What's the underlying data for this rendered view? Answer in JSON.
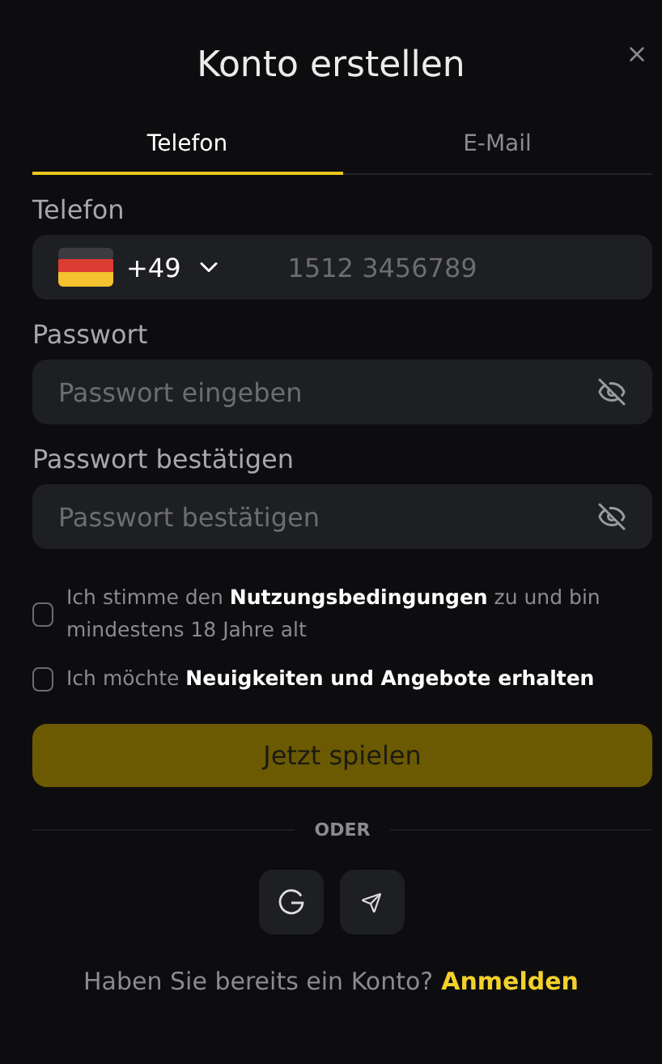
{
  "dialog": {
    "title": "Konto erstellen"
  },
  "tabs": [
    {
      "label": "Telefon",
      "selected": true
    },
    {
      "label": "E-Mail",
      "selected": false
    }
  ],
  "phone": {
    "label": "Telefon",
    "country_code": "+49",
    "placeholder": "1512 3456789"
  },
  "password": {
    "label": "Passwort",
    "placeholder": "Passwort eingeben"
  },
  "password_confirm": {
    "label": "Passwort bestätigen",
    "placeholder": "Passwort bestätigen"
  },
  "checkboxes": [
    {
      "text": "Ich stimme den **Nutzungsbedingungen** zu und bin mindestens 18 Jahre alt",
      "checked": false
    },
    {
      "text": "Ich möchte **Neuigkeiten und Angebote erhalten**",
      "checked": false
    }
  ],
  "submit": {
    "label": "Jetzt spielen",
    "disabled": true
  },
  "divider": "ODER",
  "footer": {
    "text": "Haben Sie bereits ein Konto?",
    "link": "Anmelden"
  }
}
